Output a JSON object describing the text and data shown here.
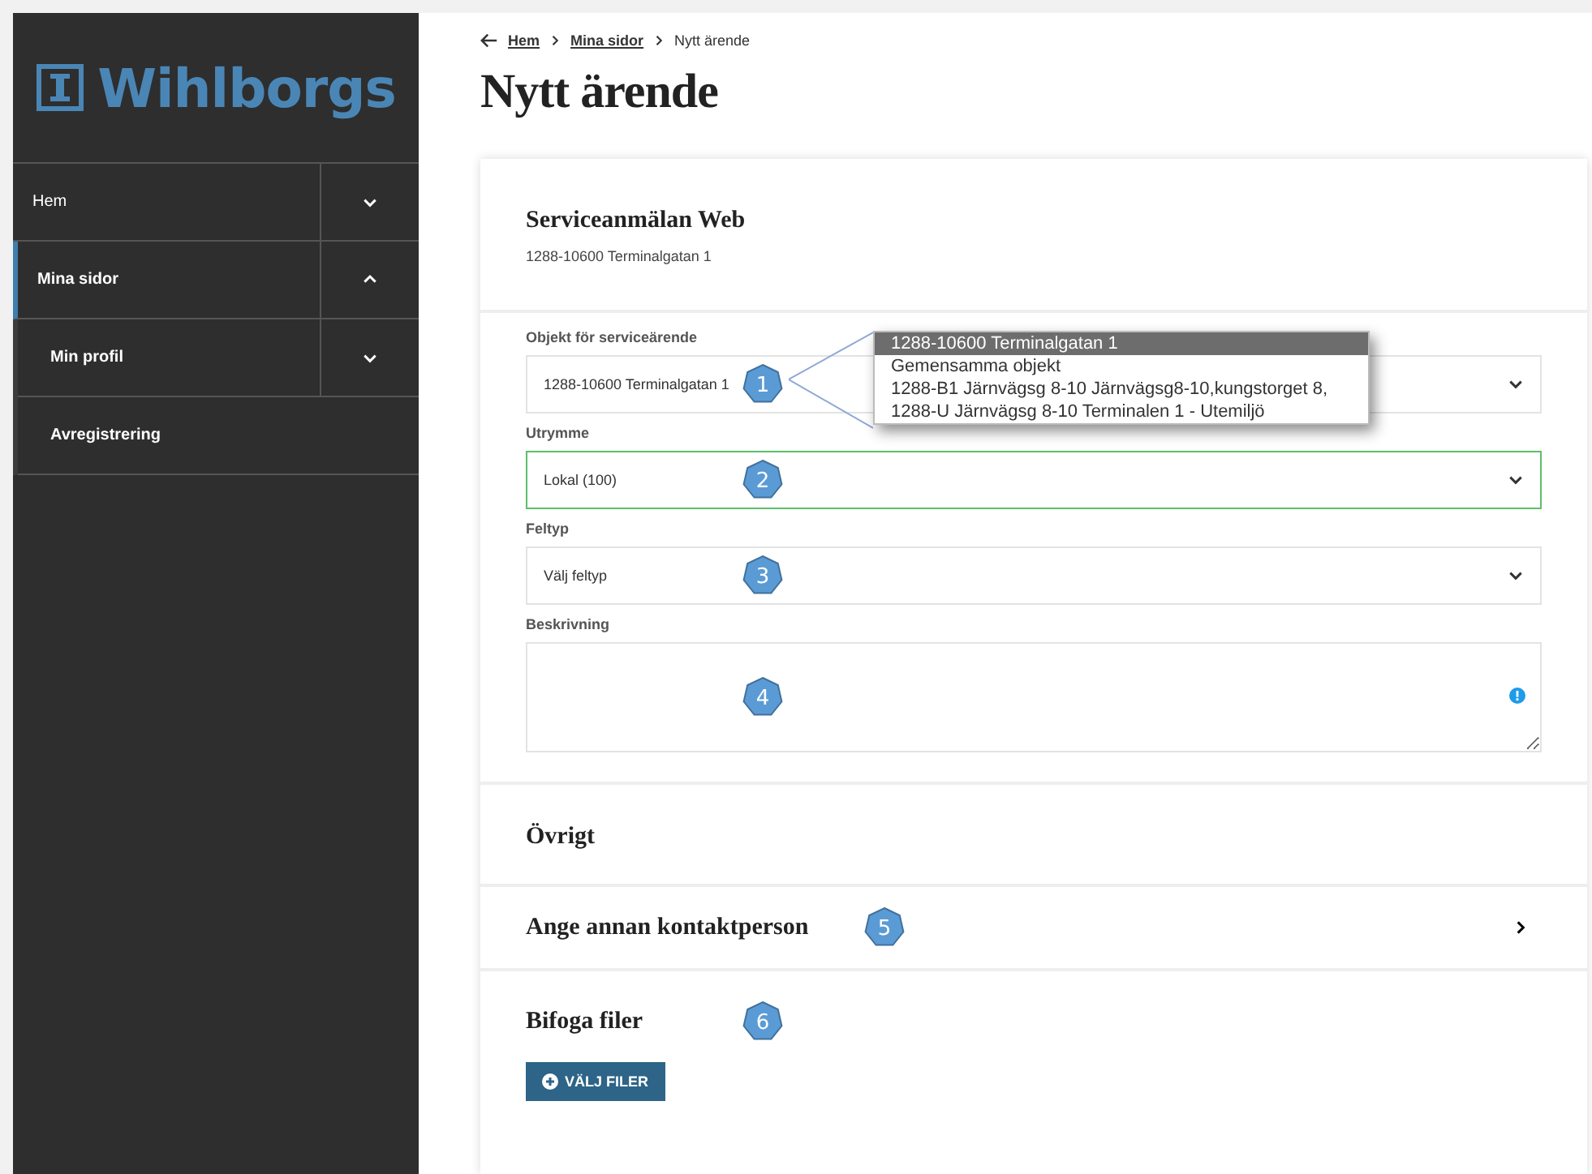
{
  "logo": {
    "name": "Wihlborgs"
  },
  "nav": [
    {
      "label": "Hem",
      "selected": false,
      "expanded": false
    },
    {
      "label": "Mina sidor",
      "selected": true,
      "expanded": true,
      "children": [
        {
          "label": "Min profil",
          "selected": false,
          "expanded": false
        },
        {
          "label": "Avregistrering",
          "selected": false
        }
      ]
    }
  ],
  "breadcrumb": [
    {
      "label": "Hem",
      "kind": "link"
    },
    {
      "label": "Mina sidor",
      "kind": "link"
    },
    {
      "label": "Nytt ärende",
      "kind": "current"
    }
  ],
  "title": "Nytt ärende",
  "form": {
    "title": "Serviceanmälan Web",
    "subtitle": "1288-10600 Terminalgatan 1",
    "fields": [
      {
        "kind": "select",
        "label": "Objekt för serviceärende",
        "value": "1288-10600 Terminalgatan 1",
        "highlighted": false,
        "badge": "1",
        "options": [
          {
            "label": "1288-10600 Terminalgatan 1",
            "selected": true
          },
          {
            "label": "Gemensamma objekt",
            "selected": false
          },
          {
            "label": "1288-B1 Järnvägsg 8-10 Järnvägsg8-10,kungstorget 8,",
            "selected": false
          },
          {
            "label": "1288-U Järnvägsg 8-10 Terminalen 1 - Utemiljö",
            "selected": false
          }
        ]
      },
      {
        "kind": "select",
        "label": "Utrymme",
        "value": "Lokal (100)",
        "highlighted": true,
        "badge": "2"
      },
      {
        "kind": "select",
        "label": "Feltyp",
        "value": "Välj feltyp",
        "highlighted": false,
        "badge": "3"
      },
      {
        "kind": "textarea",
        "label": "Beskrivning",
        "badge": "4"
      }
    ]
  },
  "sections": [
    {
      "kind": "heading",
      "title": "Övrigt"
    },
    {
      "kind": "collapsible",
      "title": "Ange annan kontaktperson",
      "badge": "5"
    },
    {
      "kind": "upload",
      "title": "Bifoga filer",
      "badge": "6",
      "button": "VÄLJ FILER"
    }
  ]
}
